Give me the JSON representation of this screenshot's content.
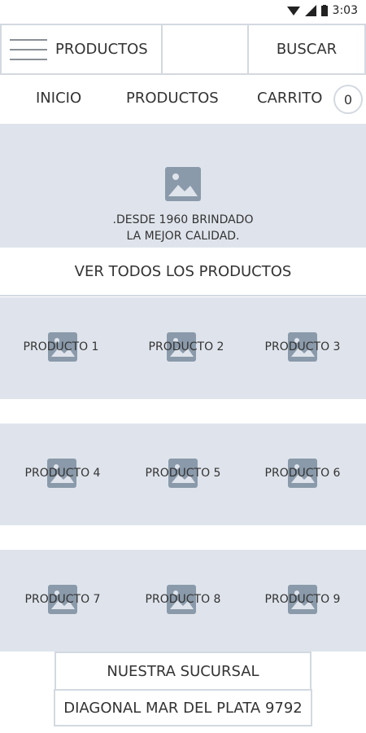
{
  "status_bar": {
    "time": "3:03"
  },
  "topbar": {
    "title": "PRODUCTOS",
    "search_label": "BUSCAR"
  },
  "nav": {
    "items": [
      {
        "label": "INICIO"
      },
      {
        "label": "PRODUCTOS"
      },
      {
        "label": "CARRITO"
      }
    ],
    "cart_count": "0"
  },
  "hero": {
    "line1": ".DESDE 1960 BRINDADO",
    "line2": "LA MEJOR CALIDAD."
  },
  "see_all_label": "VER TODOS LOS PRODUCTOS",
  "products": [
    {
      "label": "PRODUCTO 1"
    },
    {
      "label": "PRODUCTO 2"
    },
    {
      "label": "PRODUCTO 3"
    },
    {
      "label": "PRODUCTO 4"
    },
    {
      "label": "PRODUCTO 5"
    },
    {
      "label": "PRODUCTO 6"
    },
    {
      "label": "PRODUCTO 7"
    },
    {
      "label": "PRODUCTO 8"
    },
    {
      "label": "PRODUCTO 9"
    }
  ],
  "branch": {
    "title": "NUESTRA SUCURSAL",
    "address": "DIAGONAL MAR DEL PLATA 9792"
  },
  "colors": {
    "placeholder_bg": "#dfe4ec",
    "border": "#d3d9e0",
    "icon": "#8a9aaa",
    "text": "#333333"
  }
}
